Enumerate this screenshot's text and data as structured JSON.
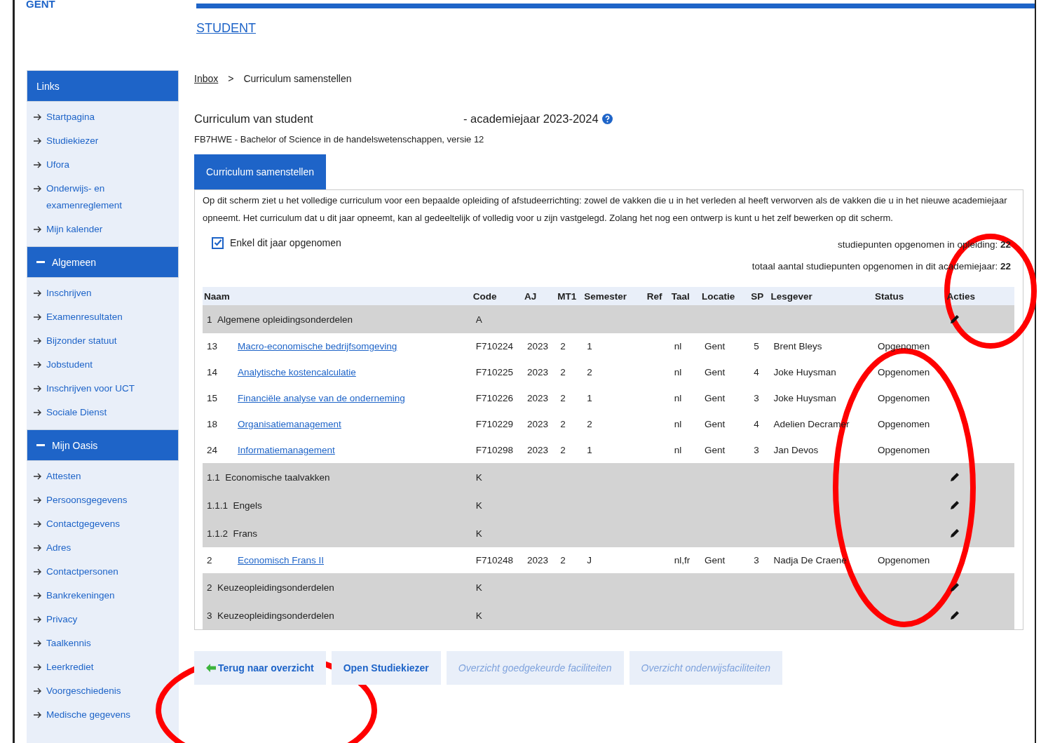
{
  "header": {
    "logo": "GENT",
    "student_link": "STUDENT"
  },
  "sidebar": {
    "sections": [
      {
        "title": "Links",
        "kind": "plain",
        "items": [
          "Startpagina",
          "Studiekiezer",
          "Ufora",
          "Onderwijs- en examenreglement",
          "Mijn kalender"
        ]
      },
      {
        "title": "Algemeen",
        "kind": "toggle",
        "expanded": true,
        "items": [
          "Inschrijven",
          "Examenresultaten",
          "Bijzonder statuut",
          "Jobstudent",
          "Inschrijven voor UCT",
          "Sociale Dienst"
        ]
      },
      {
        "title": "Mijn Oasis",
        "kind": "toggle",
        "expanded": true,
        "items": [
          "Attesten",
          "Persoonsgegevens",
          "Contactgegevens",
          "Adres",
          "Contactpersonen",
          "Bankrekeningen",
          "Privacy",
          "Taalkennis",
          "Leerkrediet",
          "Voorgeschiedenis",
          "Medische gegevens"
        ]
      }
    ]
  },
  "breadcrumb": {
    "link": "Inbox",
    "separator": ">",
    "current": "Curriculum samenstellen"
  },
  "title": {
    "left": "Curriculum van student",
    "right": "- academiejaar 2023-2024",
    "subtitle": "FB7HWE - Bachelor of Science in de handelswetenschappen, versie 12"
  },
  "tabs": [
    {
      "label": "Curriculum samenstellen",
      "selected": true
    }
  ],
  "intro": "Op dit scherm ziet u het volledige curriculum voor een bepaalde opleiding of afstudeerrichting: zowel de vakken die u in het verleden al heeft verworven als de vakken die u in het nieuwe academiejaar opneemt. Het curriculum dat u dit jaar opneemt, kan al gedeeltelijk of volledig voor u zijn vastgelegd. Zolang het nog een ontwerp is kunt u het zelf bewerken op dit scherm.",
  "filter": {
    "label": "Enkel dit jaar opgenomen",
    "checked": true
  },
  "totals": [
    {
      "label": "studiepunten opgenomen in opleiding:",
      "value": "22"
    },
    {
      "label": "totaal aantal studiepunten opgenomen in dit academiejaar:",
      "value": "22"
    }
  ],
  "table": {
    "columns": [
      "Naam",
      "Code",
      "AJ",
      "MT1",
      "Semester",
      "Ref",
      "Taal",
      "Locatie",
      "SP",
      "Lesgever",
      "Status",
      "Acties"
    ],
    "rows": [
      {
        "kind": "group",
        "number": "1",
        "name": "Algemene opleidingsonderdelen",
        "code": "A"
      },
      {
        "kind": "course",
        "number": "13",
        "name": "Macro-economische bedrijfsomgeving",
        "code": "F710224",
        "aj": "2023",
        "mt1": "2",
        "semester": "1",
        "taal": "nl",
        "locatie": "Gent",
        "sp": "5",
        "lesgever": "Brent Bleys",
        "status": "Opgenomen"
      },
      {
        "kind": "course",
        "number": "14",
        "name": "Analytische kostencalculatie",
        "code": "F710225",
        "aj": "2023",
        "mt1": "2",
        "semester": "2",
        "taal": "nl",
        "locatie": "Gent",
        "sp": "4",
        "lesgever": "Joke Huysman",
        "status": "Opgenomen"
      },
      {
        "kind": "course",
        "number": "15",
        "name": "Financiële analyse van de onderneming",
        "code": "F710226",
        "aj": "2023",
        "mt1": "2",
        "semester": "1",
        "taal": "nl",
        "locatie": "Gent",
        "sp": "3",
        "lesgever": "Joke Huysman",
        "status": "Opgenomen"
      },
      {
        "kind": "course",
        "number": "18",
        "name": "Organisatiemanagement",
        "code": "F710229",
        "aj": "2023",
        "mt1": "2",
        "semester": "2",
        "taal": "nl",
        "locatie": "Gent",
        "sp": "4",
        "lesgever": "Adelien Decramer",
        "status": "Opgenomen"
      },
      {
        "kind": "course",
        "number": "24",
        "name": "Informatiemanagement",
        "code": "F710298",
        "aj": "2023",
        "mt1": "2",
        "semester": "1",
        "taal": "nl",
        "locatie": "Gent",
        "sp": "3",
        "lesgever": "Jan Devos",
        "status": "Opgenomen"
      },
      {
        "kind": "group",
        "number": "1.1",
        "name": "Economische taalvakken",
        "code": "K"
      },
      {
        "kind": "group",
        "number": "1.1.1",
        "name": "Engels",
        "code": "K"
      },
      {
        "kind": "group",
        "number": "1.1.2",
        "name": "Frans",
        "code": "K"
      },
      {
        "kind": "course",
        "number": "2",
        "name": "Economisch Frans II",
        "code": "F710248",
        "aj": "2023",
        "mt1": "2",
        "semester": "J",
        "taal": "nl,fr",
        "locatie": "Gent",
        "sp": "3",
        "lesgever": "Nadja De Craene",
        "status": "Opgenomen"
      },
      {
        "kind": "group",
        "number": "2",
        "name": "Keuzeopleidingsonderdelen",
        "code": "K"
      },
      {
        "kind": "group",
        "number": "3",
        "name": "Keuzeopleidingsonderdelen",
        "code": "K"
      }
    ]
  },
  "buttons": [
    {
      "label": "Terug naar overzicht",
      "kind": "back",
      "disabled": false
    },
    {
      "label": "Open Studiekiezer",
      "kind": "plain",
      "disabled": false
    },
    {
      "label": "Overzicht goedgekeurde faciliteiten",
      "kind": "plain",
      "disabled": true
    },
    {
      "label": "Overzicht onderwijsfaciliteiten",
      "kind": "plain",
      "disabled": true
    }
  ],
  "annotations": [
    {
      "kind": "ellipse"
    },
    {
      "kind": "ellipse"
    },
    {
      "kind": "ellipse"
    }
  ]
}
